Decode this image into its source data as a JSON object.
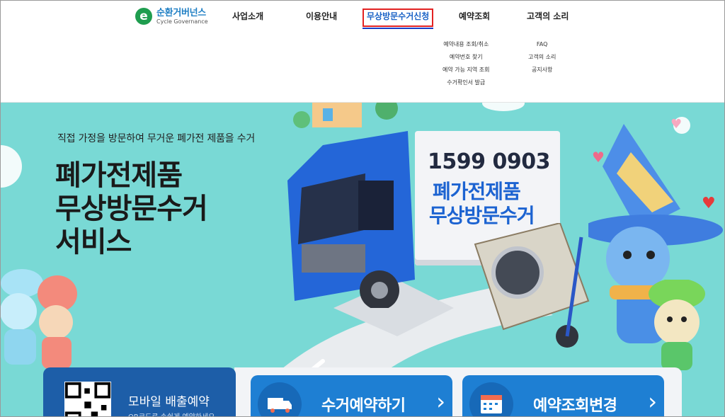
{
  "logo": {
    "name_ko": "순환거버넌스",
    "name_en": "Cycle Governance"
  },
  "nav": [
    {
      "label": "사업소개"
    },
    {
      "label": "이용안내"
    },
    {
      "label": "무상방문수거신청"
    },
    {
      "label": "예약조회"
    },
    {
      "label": "고객의 소리"
    }
  ],
  "submenus": {
    "reservation": [
      "예약내용 조회/취소",
      "예약번호 찾기",
      "예약 가능 지역 조회",
      "수거확인서 발급"
    ],
    "customer": [
      "FAQ",
      "고객의 소리",
      "공지사항"
    ]
  },
  "hero": {
    "subtitle": "직접 가정을 방문하여 무거운 폐가전 제품을 수거",
    "title_lines": [
      "폐가전제품",
      "무상방문수거",
      "서비스"
    ],
    "truck_phone": "1599 0903",
    "truck_line1": "폐가전제품",
    "truck_line2": "무상방문수거"
  },
  "cards": {
    "mobile_label": "모바일 배출예약",
    "mobile_desc": "QR코드로 손쉽게 예약하세요",
    "reserve_label": "수거예약하기",
    "lookup_label": "예약조회변경",
    "chevron": "›"
  },
  "colors": {
    "accent_blue": "#1b63c6",
    "active_border": "#e32222",
    "hero_bg": "#79d9d5",
    "card_blue": "#1e7fd3",
    "card_dark": "#1d5ea8"
  }
}
